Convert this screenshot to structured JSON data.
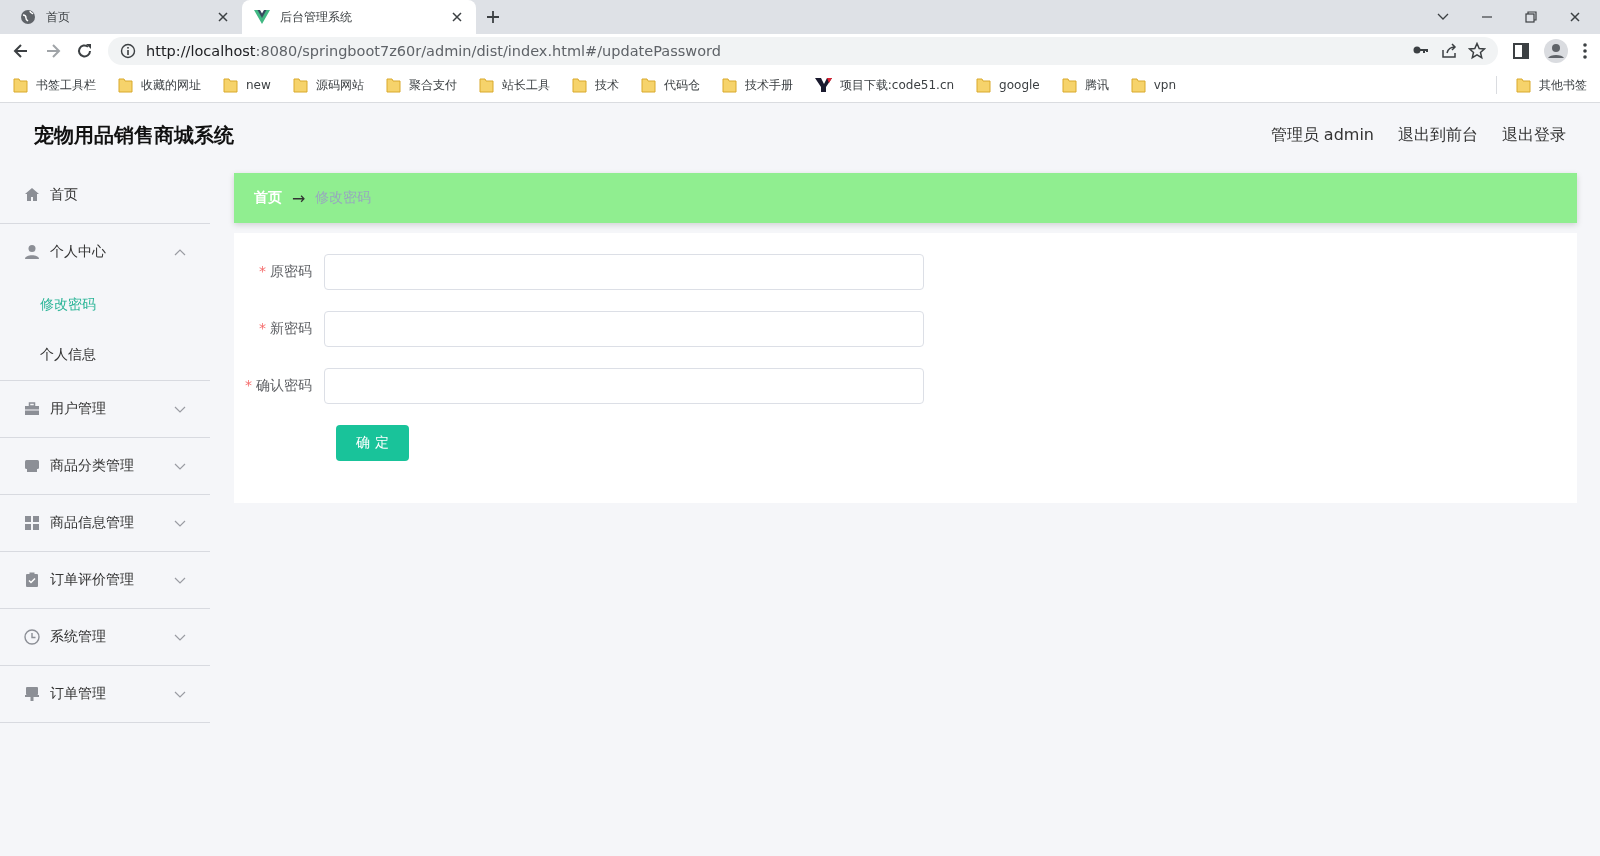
{
  "browser": {
    "tabs": [
      {
        "title": "首页",
        "selected": false
      },
      {
        "title": "后台管理系统",
        "selected": true
      }
    ],
    "address": {
      "scheme_host": "http://localhost",
      "rest": ":8080/springboot7z60r/admin/dist/index.html#/updatePassword"
    },
    "bookmarks": [
      {
        "kind": "folder",
        "label": "书签工具栏"
      },
      {
        "kind": "folder",
        "label": "收藏的网址"
      },
      {
        "kind": "folder",
        "label": "new"
      },
      {
        "kind": "folder",
        "label": "源码网站"
      },
      {
        "kind": "folder",
        "label": "聚合支付"
      },
      {
        "kind": "folder",
        "label": "站长工具"
      },
      {
        "kind": "folder",
        "label": "技术"
      },
      {
        "kind": "folder",
        "label": "代码仓"
      },
      {
        "kind": "folder",
        "label": "技术手册"
      },
      {
        "kind": "site",
        "label": "项目下载:code51.cn"
      },
      {
        "kind": "folder",
        "label": "google"
      },
      {
        "kind": "folder",
        "label": "腾讯"
      },
      {
        "kind": "folder",
        "label": "vpn"
      }
    ],
    "other_bookmarks": "其他书签"
  },
  "header": {
    "title": "宠物用品销售商城系统",
    "user": "管理员 admin",
    "links": [
      "退出到前台",
      "退出登录"
    ]
  },
  "sidebar": {
    "items": [
      {
        "label": "首页",
        "selected": false
      },
      {
        "label": "个人中心",
        "expanded": true,
        "children": [
          {
            "label": "修改密码",
            "selected": true
          },
          {
            "label": "个人信息",
            "selected": false
          }
        ]
      },
      {
        "label": "用户管理",
        "expanded": false
      },
      {
        "label": "商品分类管理",
        "expanded": false
      },
      {
        "label": "商品信息管理",
        "expanded": false
      },
      {
        "label": "订单评价管理",
        "expanded": false
      },
      {
        "label": "系统管理",
        "expanded": false
      },
      {
        "label": "订单管理",
        "expanded": false
      }
    ]
  },
  "breadcrumb": {
    "home": "首页",
    "separator": "→",
    "current": "修改密码"
  },
  "form": {
    "fields": [
      {
        "label": "原密码",
        "required": true,
        "marker": "*"
      },
      {
        "label": "新密码",
        "required": true,
        "marker": "*"
      },
      {
        "label": "确认密码",
        "required": true,
        "marker": "*"
      }
    ],
    "submit": "确 定"
  }
}
